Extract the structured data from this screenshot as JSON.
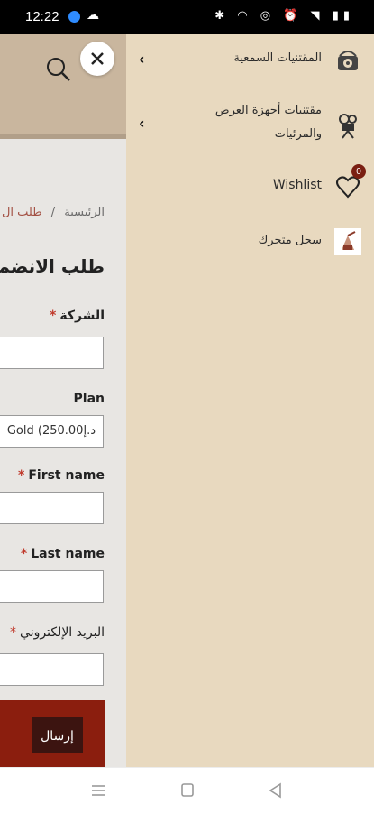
{
  "status_bar": {
    "time": "12:22"
  },
  "drawer": {
    "items": [
      {
        "label": "المقتنيات السمعية",
        "icon": "gramophone-icon",
        "has_submenu": true
      },
      {
        "label": "مقتنيات أجهزة العرض والمرئيات",
        "icon": "film-camera-icon",
        "has_submenu": true
      },
      {
        "label": "Wishlist",
        "icon": "heart-icon",
        "badge": "0"
      },
      {
        "label": "سجل متجرك",
        "icon": "register-store-icon"
      }
    ]
  },
  "page": {
    "breadcrumb": {
      "home": "الرئيسية",
      "separator": "/",
      "current": "طلب ال"
    },
    "title": "طلب الانضما",
    "fields": {
      "company_label": "الشركة",
      "plan_label": "Plan",
      "plan_value": "Gold (د.إ250.00",
      "first_name_label": "First name",
      "last_name_label": "Last name",
      "email_label": "البريد الإلكتروني"
    },
    "submit_label": "إرسال"
  },
  "colors": {
    "drawer_bg": "#e8d9bf",
    "header_bg": "#c9b69e",
    "accent": "#8b1e0e",
    "badge": "#7a1f12"
  }
}
